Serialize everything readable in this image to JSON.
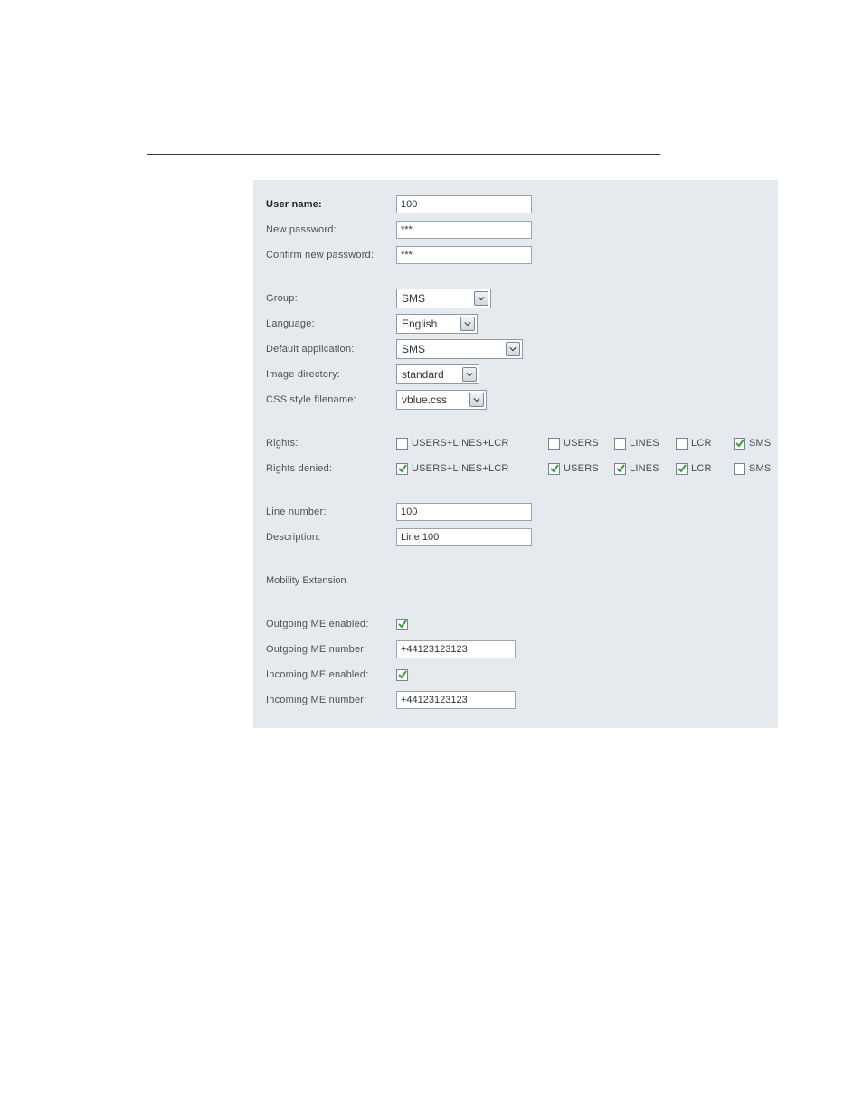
{
  "user": {
    "name_label": "User name:",
    "name_value": "100",
    "new_pw_label": "New password:",
    "new_pw_value": "***",
    "confirm_pw_label": "Confirm new password:",
    "confirm_pw_value": "***"
  },
  "general": {
    "group_label": "Group:",
    "group_value": "SMS",
    "language_label": "Language:",
    "language_value": "English",
    "default_app_label": "Default application:",
    "default_app_value": "SMS",
    "image_dir_label": "Image directory:",
    "image_dir_value": "standard",
    "css_label": "CSS style filename:",
    "css_value": "vblue.css"
  },
  "rights": {
    "rights_label": "Rights:",
    "rights_denied_label": "Rights denied:",
    "options": {
      "ulc": "USERS+LINES+LCR",
      "users": "USERS",
      "lines": "LINES",
      "lcr": "LCR",
      "sms": "SMS"
    },
    "allowed": {
      "ulc": false,
      "users": false,
      "lines": false,
      "lcr": false,
      "sms": true
    },
    "denied": {
      "ulc": true,
      "users": true,
      "lines": true,
      "lcr": true,
      "sms": false
    }
  },
  "line": {
    "number_label": "Line number:",
    "number_value": "100",
    "description_label": "Description:",
    "description_value": "Line 100"
  },
  "me": {
    "heading": "Mobility Extension",
    "out_enabled_label": "Outgoing ME enabled:",
    "out_enabled": true,
    "out_number_label": "Outgoing ME number:",
    "out_number_value": "+44123123123",
    "in_enabled_label": "Incoming ME enabled:",
    "in_enabled": true,
    "in_number_label": "Incoming ME number:",
    "in_number_value": "+44123123123"
  }
}
